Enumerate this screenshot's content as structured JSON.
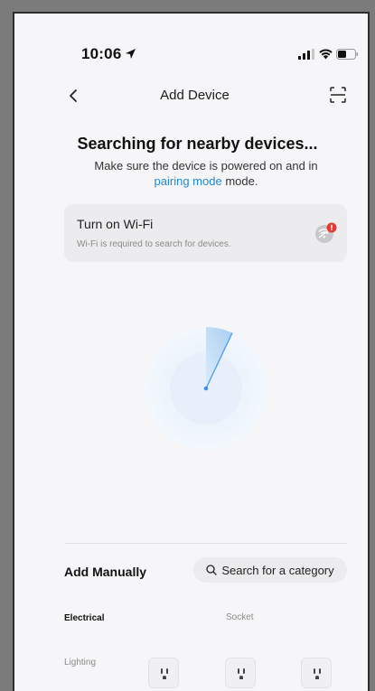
{
  "status_bar": {
    "time": "10:06",
    "location_icon": "location-arrow-icon",
    "signal_icon": "cellular-signal-icon",
    "wifi_icon": "wifi-icon",
    "battery_icon": "battery-icon"
  },
  "nav": {
    "title": "Add Device",
    "back_icon": "chevron-left-icon",
    "scan_icon": "scan-icon"
  },
  "search": {
    "title": "Searching for nearby devices...",
    "subtitle_pre": "Make sure the device is powered on and in",
    "link": "pairing mode",
    "subtitle_post": " mode."
  },
  "wifi_card": {
    "title": "Turn on Wi-Fi",
    "subtitle": "Wi-Fi is required to search for devices.",
    "icon": "wifi-off-alert-icon",
    "alert_color": "#e53935"
  },
  "radar": {
    "icon": "radar-scan-icon",
    "accent": "#4a9de8"
  },
  "manual": {
    "title": "Add Manually",
    "search_placeholder": "Search for a category",
    "search_icon": "search-icon"
  },
  "categories": {
    "left": [
      "Electrical",
      "Lighting"
    ],
    "section_header": "Socket",
    "device_icon": "power-socket-icon",
    "device_count": 3
  },
  "colors": {
    "link": "#1e88d8",
    "background": "#f6f6f8",
    "card": "#ececee"
  }
}
